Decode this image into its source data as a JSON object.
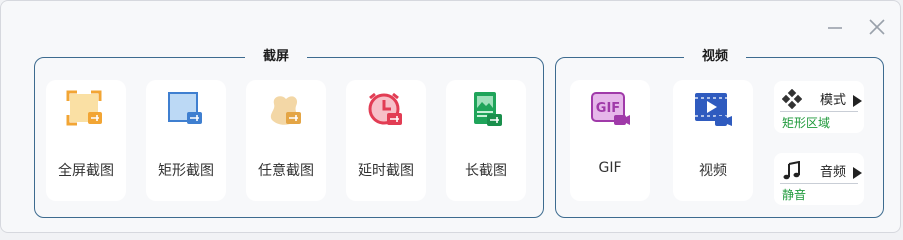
{
  "window": {
    "controls": {
      "minimize_icon": "minimize-icon",
      "close_icon": "close-icon"
    }
  },
  "screenshot_group": {
    "title": "截屏",
    "items": [
      {
        "label": "全屏截图",
        "icon": "fullscreen-capture-icon"
      },
      {
        "label": "矩形截图",
        "icon": "rect-capture-icon"
      },
      {
        "label": "任意截图",
        "icon": "freeform-capture-icon"
      },
      {
        "label": "延时截图",
        "icon": "delayed-capture-icon"
      },
      {
        "label": "长截图",
        "icon": "long-capture-icon"
      }
    ]
  },
  "video_group": {
    "title": "视频",
    "items": [
      {
        "label": "GIF",
        "icon": "gif-record-icon"
      },
      {
        "label": "视频",
        "icon": "video-record-icon"
      }
    ],
    "mode": {
      "label": "模式",
      "value": "矩形区域",
      "icon": "mode-icon"
    },
    "audio": {
      "label": "音频",
      "value": "静音",
      "icon": "music-note-icon"
    }
  },
  "colors": {
    "group_border": "#3d6b8f",
    "accent_green": "#1f9a3b",
    "accent_orange": "#f2a534",
    "accent_blue": "#3f7fd0",
    "accent_red": "#e23d54",
    "accent_purple": "#a03aa9"
  }
}
